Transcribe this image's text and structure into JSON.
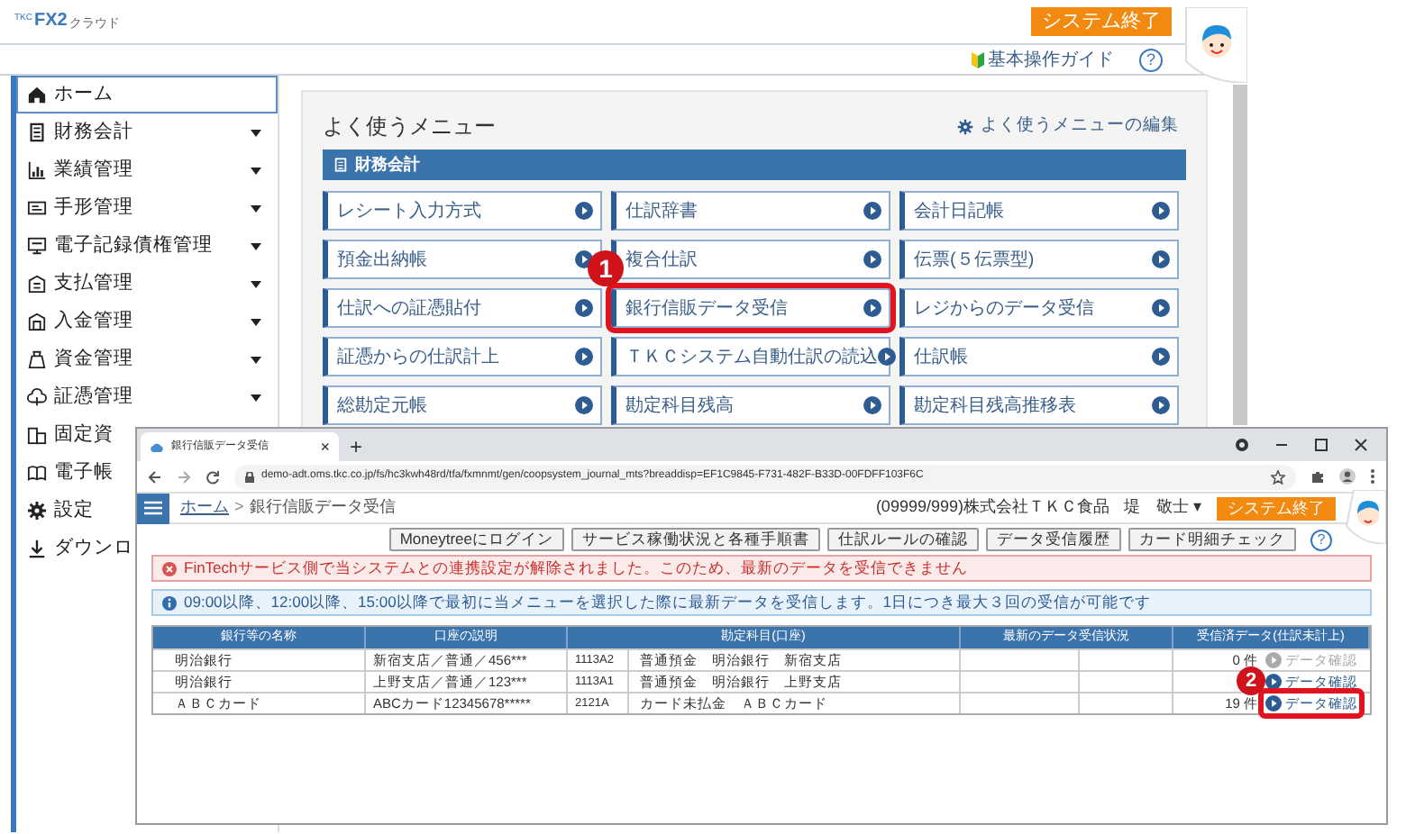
{
  "header": {
    "logo_small": "TKC",
    "logo_main": "FX2",
    "logo_sub": "クラウド",
    "exit_button": "システム終了",
    "guide_link": "基本操作ガイド",
    "help": "?"
  },
  "sidebar": {
    "items": [
      {
        "label": "ホーム",
        "selected": true,
        "expandable": false
      },
      {
        "label": "財務会計",
        "selected": false,
        "expandable": true
      },
      {
        "label": "業績管理",
        "selected": false,
        "expandable": true
      },
      {
        "label": "手形管理",
        "selected": false,
        "expandable": true
      },
      {
        "label": "電子記録債権管理",
        "selected": false,
        "expandable": true
      },
      {
        "label": "支払管理",
        "selected": false,
        "expandable": true
      },
      {
        "label": "入金管理",
        "selected": false,
        "expandable": true
      },
      {
        "label": "資金管理",
        "selected": false,
        "expandable": true
      },
      {
        "label": "証憑管理",
        "selected": false,
        "expandable": true
      },
      {
        "label": "固定資",
        "selected": false,
        "expandable": false
      },
      {
        "label": "電子帳",
        "selected": false,
        "expandable": false
      },
      {
        "label": "設定",
        "selected": false,
        "expandable": false
      },
      {
        "label": "ダウンロ",
        "selected": false,
        "expandable": false
      }
    ]
  },
  "menu": {
    "title": "よく使うメニュー",
    "edit_link": "よく使うメニューの編集",
    "category": "財務会計",
    "items": [
      {
        "label": "レシート入力方式",
        "highlighted": false
      },
      {
        "label": "仕訳辞書",
        "highlighted": false
      },
      {
        "label": "会計日記帳",
        "highlighted": false
      },
      {
        "label": "預金出納帳",
        "highlighted": false
      },
      {
        "label": "複合仕訳",
        "highlighted": false
      },
      {
        "label": "伝票(５伝票型)",
        "highlighted": false
      },
      {
        "label": "仕訳への証憑貼付",
        "highlighted": false
      },
      {
        "label": "銀行信販データ受信",
        "highlighted": true
      },
      {
        "label": "レジからのデータ受信",
        "highlighted": false
      },
      {
        "label": "証憑からの仕訳計上",
        "highlighted": false
      },
      {
        "label": "ＴＫＣシステム自動仕訳の読込",
        "highlighted": false
      },
      {
        "label": "仕訳帳",
        "highlighted": false
      },
      {
        "label": "総勘定元帳",
        "highlighted": false
      },
      {
        "label": "勘定科目残高",
        "highlighted": false
      },
      {
        "label": "勘定科目残高推移表",
        "highlighted": false
      }
    ]
  },
  "window": {
    "tab_title": "銀行信販データ受信",
    "tab_close": "×",
    "new_tab": "+",
    "url": "demo-adt.oms.tkc.co.jp/fs/hc3kwh48rd/tfa/fxmnmt/gen/coopsystem_journal_mts?breaddisp=EF1C9845-F731-482F-B33D-00FDFF103F6C",
    "breadcrumb_home": "ホーム",
    "breadcrumb_separator": ">",
    "breadcrumb_current": "銀行信販データ受信",
    "company": "(09999/999)株式会社ＴＫＣ食品",
    "user": "堤　敬士 ▾",
    "exit_button": "システム終了",
    "help": "?",
    "toolbar": [
      "Moneytreeにログイン",
      "サービス稼働状況と各種手順書",
      "仕訳ルールの確認",
      "データ受信履歴",
      "カード明細チェック"
    ],
    "error": "FinTechサービス側で当システムとの連携設定が解除されました。このため、最新のデータを受信できません",
    "info": "09:00以降、12:00以降、15:00以降で最初に当メニューを選択した際に最新データを受信します。1日につき最大３回の受信が可能です",
    "table": {
      "columns": [
        "銀行等の名称",
        "口座の説明",
        "勘定科目(口座)",
        "最新のデータ受信状況",
        "受信済データ(仕訳未計上)"
      ],
      "rows": [
        {
          "bank": "明治銀行",
          "account": "新宿支店／普通／456***",
          "code": "1113A2",
          "subject": "普通預金　明治銀行　新宿支店",
          "count": "0 件",
          "link": "データ確認",
          "link_enabled": false,
          "highlighted": false
        },
        {
          "bank": "明治銀行",
          "account": "上野支店／普通／123***",
          "code": "1113A1",
          "subject": "普通預金　明治銀行　上野支店",
          "link": "データ確認",
          "link_enabled": true,
          "highlighted": false
        },
        {
          "bank": "ＡＢＣカード",
          "account": "ABCカード12345678*****",
          "code": "2121A",
          "subject": "カード未払金　ＡＢＣカード",
          "count": "19 件",
          "link": "データ確認",
          "link_enabled": true,
          "highlighted": true
        }
      ]
    }
  },
  "callouts": [
    {
      "number": "1"
    },
    {
      "number": "2"
    }
  ]
}
